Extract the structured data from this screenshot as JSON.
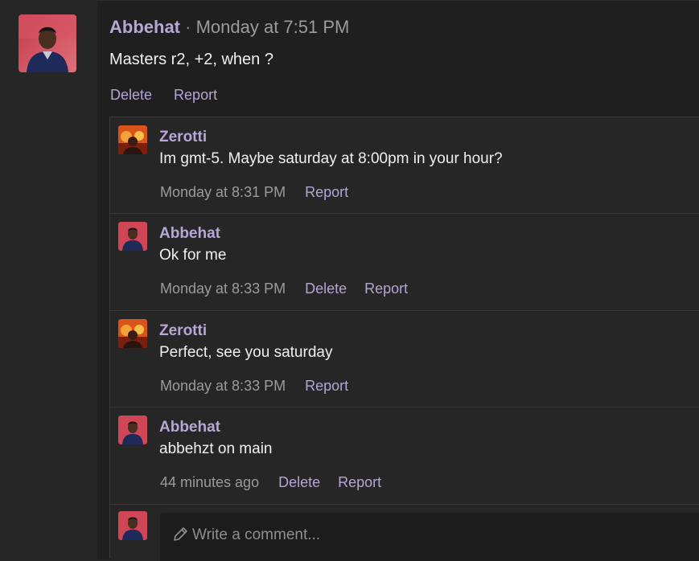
{
  "post": {
    "author": "Abbehat",
    "separator": "·",
    "timestamp": "Monday at 7:51 PM",
    "body": "Masters r2, +2, when ?",
    "actions": {
      "delete": "Delete",
      "report": "Report"
    }
  },
  "replies": [
    {
      "author": "Zerotti",
      "avatar": "zerotti-avatar",
      "body": "Im gmt-5. Maybe saturday at 8:00pm in your hour?",
      "time": "Monday at 8:31 PM",
      "delete": "",
      "report": "Report"
    },
    {
      "author": "Abbehat",
      "avatar": "abbehat-avatar",
      "body": "Ok for me",
      "time": "Monday at 8:33 PM",
      "delete": "Delete",
      "report": "Report"
    },
    {
      "author": "Zerotti",
      "avatar": "zerotti-avatar",
      "body": "Perfect, see you saturday",
      "time": "Monday at 8:33 PM",
      "delete": "",
      "report": "Report"
    },
    {
      "author": "Abbehat",
      "avatar": "abbehat-avatar",
      "body": "abbehzt on main",
      "time": "44 minutes ago",
      "delete": "Delete",
      "report": "Report"
    }
  ],
  "composer": {
    "placeholder": "Write a comment...",
    "icon": "pencil-icon"
  },
  "colors": {
    "accent": "#b3a6d4",
    "author": "#b7a7d6",
    "muted": "#9b9b9b",
    "panel": "#262626",
    "background": "#1f1f1f"
  }
}
